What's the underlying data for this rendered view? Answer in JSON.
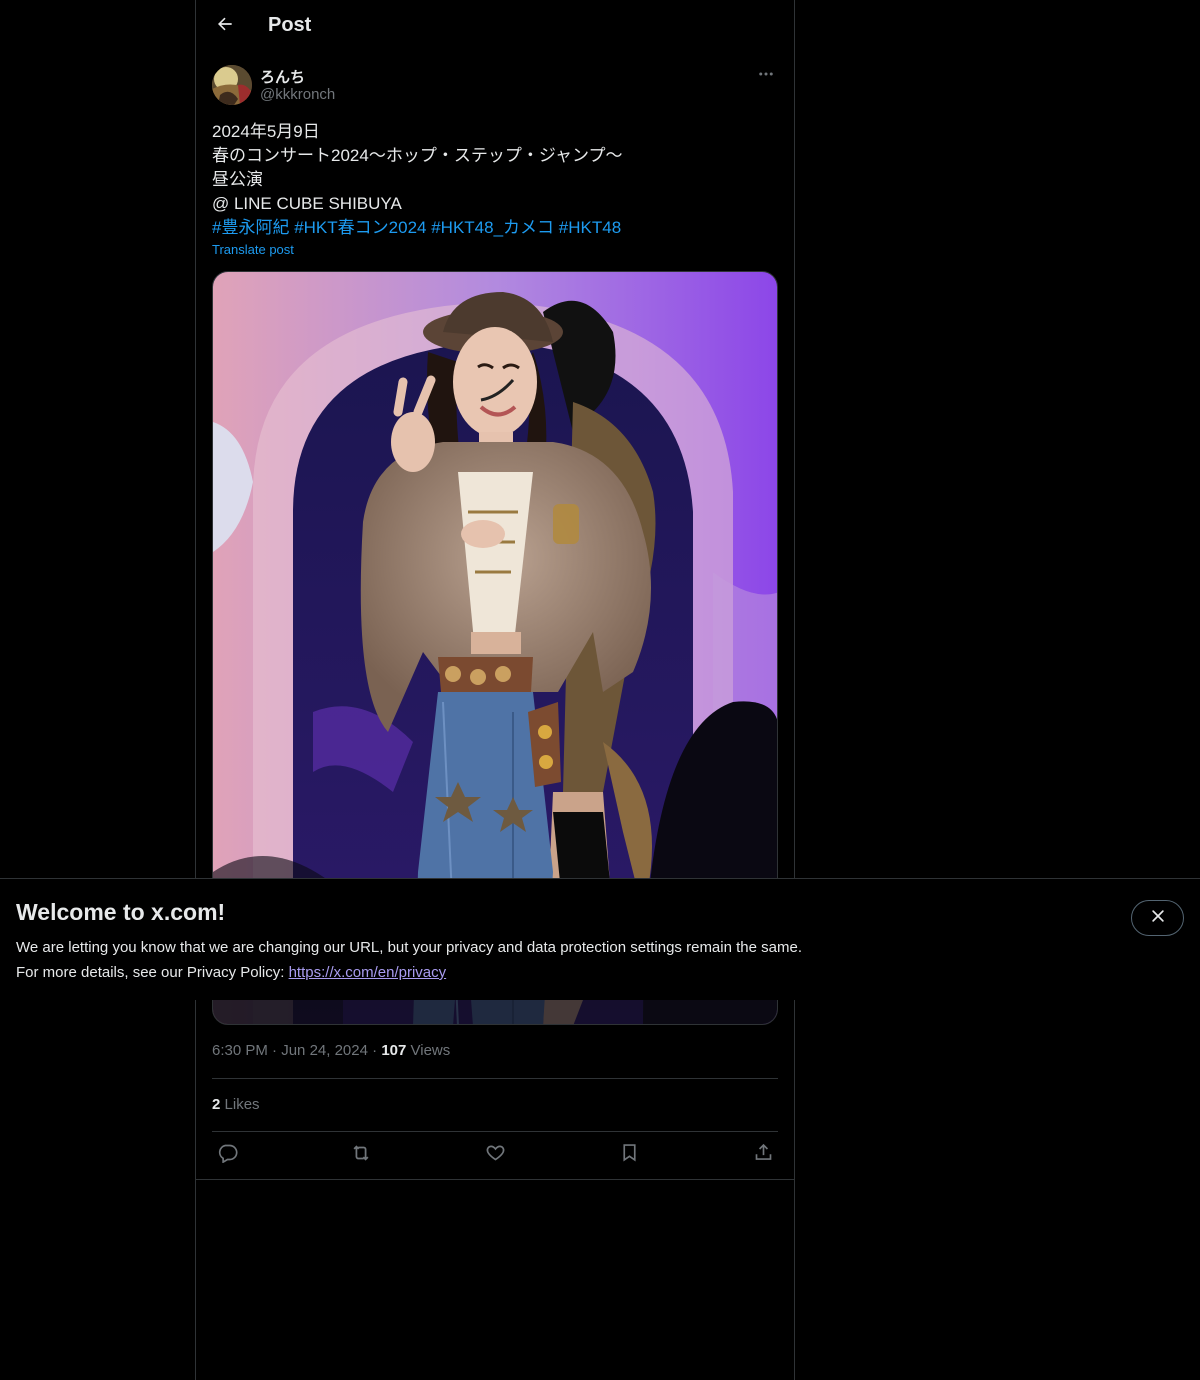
{
  "header": {
    "title": "Post"
  },
  "post": {
    "author_name": "ろんち",
    "author_handle": "@kkkronch",
    "lines": [
      "2024年5月9日",
      "春のコンサート2024〜ホップ・ステップ・ジャンプ〜",
      "昼公演",
      "@ LINE CUBE SHIBUYA"
    ],
    "hashtags": [
      "#豊永阿紀",
      "#HKT春コン2024",
      "#HKT48_カメコ",
      "#HKT48"
    ],
    "translate_label": "Translate post",
    "time": "6:30 PM",
    "date": "Jun 24, 2024",
    "views_count": "107",
    "views_label": "Views",
    "likes_count": "2",
    "likes_label": "Likes"
  },
  "banner": {
    "title": "Welcome to x.com!",
    "line1": "We are letting you know that we are changing our URL, but your privacy and data protection settings remain the same.",
    "line2_prefix": "For more details, see our Privacy Policy: ",
    "link": "https://x.com/en/privacy"
  },
  "icons": {
    "back": "arrow-left-icon",
    "more": "more-horizontal-icon",
    "reply": "reply-icon",
    "repost": "repost-icon",
    "like": "heart-icon",
    "bookmark": "bookmark-icon",
    "share": "share-icon",
    "close": "close-icon"
  },
  "colors": {
    "accent": "#1d9bf0",
    "link_banner": "#a99cf0",
    "muted": "#71767b",
    "border": "#2f3336"
  }
}
